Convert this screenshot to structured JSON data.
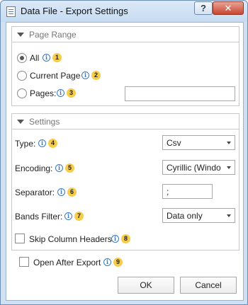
{
  "window": {
    "title": "Data File - Export Settings",
    "help_label": "?",
    "close_label": "✕"
  },
  "page_range": {
    "title": "Page Range",
    "options": [
      {
        "label": "All",
        "selected": true,
        "badge": "1"
      },
      {
        "label": "Current Page",
        "selected": false,
        "badge": "2"
      },
      {
        "label": "Pages:",
        "selected": false,
        "badge": "3"
      }
    ],
    "pages_value": ""
  },
  "settings": {
    "title": "Settings",
    "type": {
      "label": "Type:",
      "badge": "4",
      "value": "Csv"
    },
    "encoding": {
      "label": "Encoding:",
      "badge": "5",
      "value": "Cyrillic (Windo"
    },
    "separator": {
      "label": "Separator:",
      "badge": "6",
      "value": ";"
    },
    "bands_filter": {
      "label": "Bands Filter:",
      "badge": "7",
      "value": "Data only"
    },
    "skip_headers": {
      "label": "Skip Column Headers",
      "badge": "8",
      "checked": false
    }
  },
  "open_after_export": {
    "label": "Open After Export",
    "badge": "9",
    "checked": false
  },
  "buttons": {
    "ok": "OK",
    "cancel": "Cancel"
  },
  "info_glyph": "i",
  "colors": {
    "accent": "#3a77c0",
    "badge": "#f6cc4b",
    "title_bar": "#cfe0f3"
  }
}
